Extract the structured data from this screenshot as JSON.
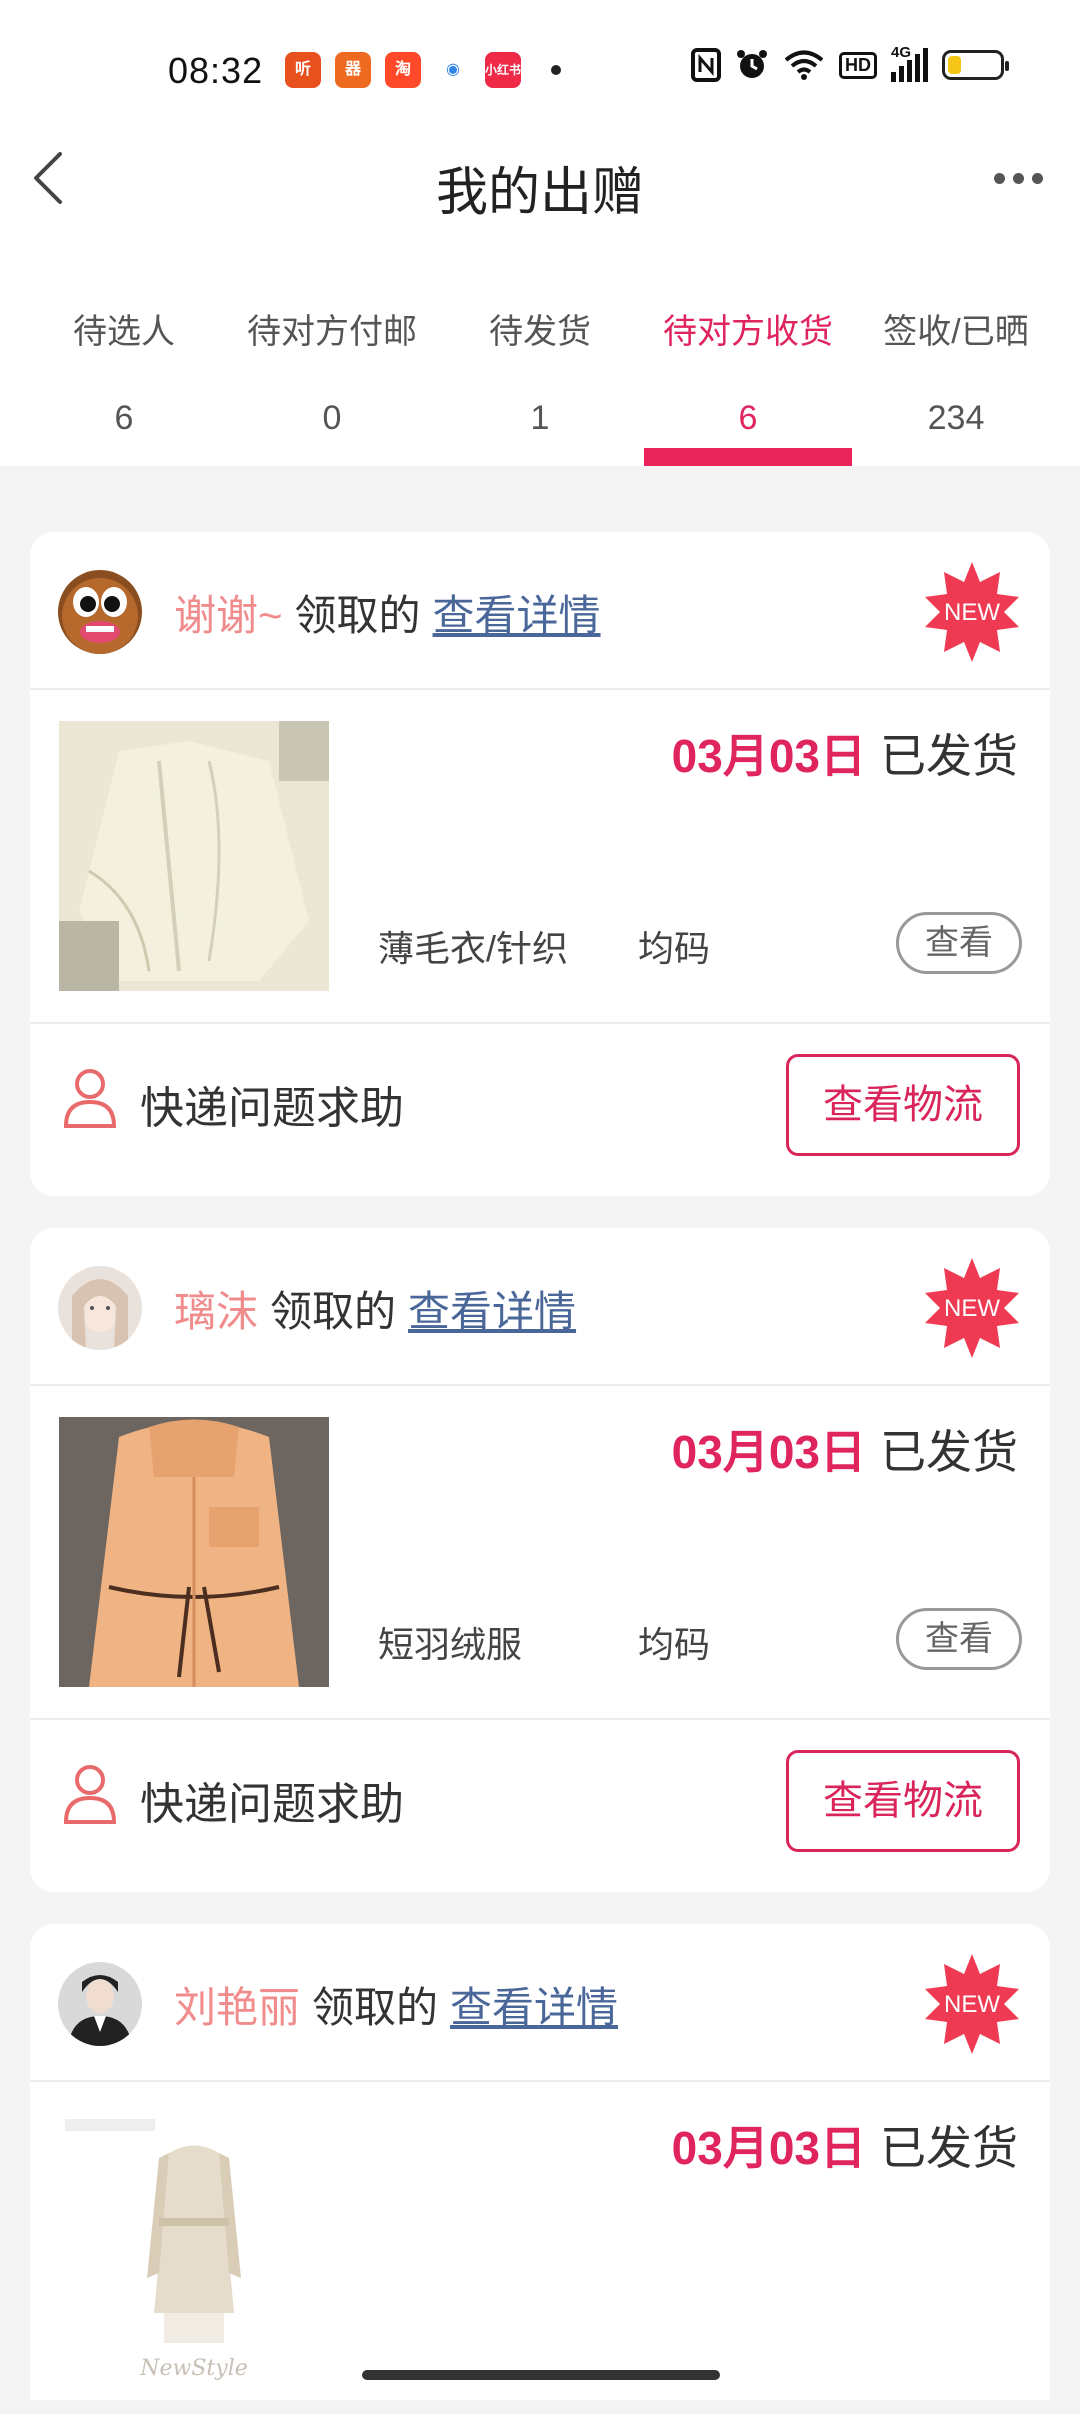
{
  "status_bar": {
    "time": "08:32",
    "apps": [
      {
        "label": "听",
        "color": "#e8501e"
      },
      {
        "label": "器",
        "color": "#ee6a20"
      },
      {
        "label": "淘",
        "color": "#ff4a2a"
      },
      {
        "label": "◉",
        "color": "#2f86e8"
      },
      {
        "label": "小红书",
        "color": "#ee2a46"
      }
    ],
    "network_label": "4G",
    "hd_label": "HD",
    "battery_level": 0.25
  },
  "nav": {
    "title": "我的出赠"
  },
  "tabs": [
    {
      "label": "待选人",
      "count": "6",
      "active": false
    },
    {
      "label": "待对方付邮",
      "count": "0",
      "active": false
    },
    {
      "label": "待发货",
      "count": "1",
      "active": false
    },
    {
      "label": "待对方收货",
      "count": "6",
      "active": true
    },
    {
      "label": "签收/已晒",
      "count": "234",
      "active": false
    }
  ],
  "orders": [
    {
      "user": "谢谢~",
      "claimed": "领取的",
      "detail_link": "查看详情",
      "badge": "NEW",
      "date": "03月03日",
      "status": "已发货",
      "category": "薄毛衣/针织",
      "size": "均码",
      "view_label": "查看",
      "help_label": "快递问题求助",
      "logistics_label": "查看物流"
    },
    {
      "user": "璃沫",
      "claimed": "领取的",
      "detail_link": "查看详情",
      "badge": "NEW",
      "date": "03月03日",
      "status": "已发货",
      "category": "短羽绒服",
      "size": "均码",
      "view_label": "查看",
      "help_label": "快递问题求助",
      "logistics_label": "查看物流"
    },
    {
      "user": "刘艳丽",
      "claimed": "领取的",
      "detail_link": "查看详情",
      "badge": "NEW",
      "date": "03月03日",
      "status": "已发货",
      "photo_caption": "NewStyle"
    }
  ],
  "colors": {
    "accent": "#e0245e",
    "username": "#f08c8c",
    "link": "#4a6799",
    "badge": "#ee3b53"
  }
}
